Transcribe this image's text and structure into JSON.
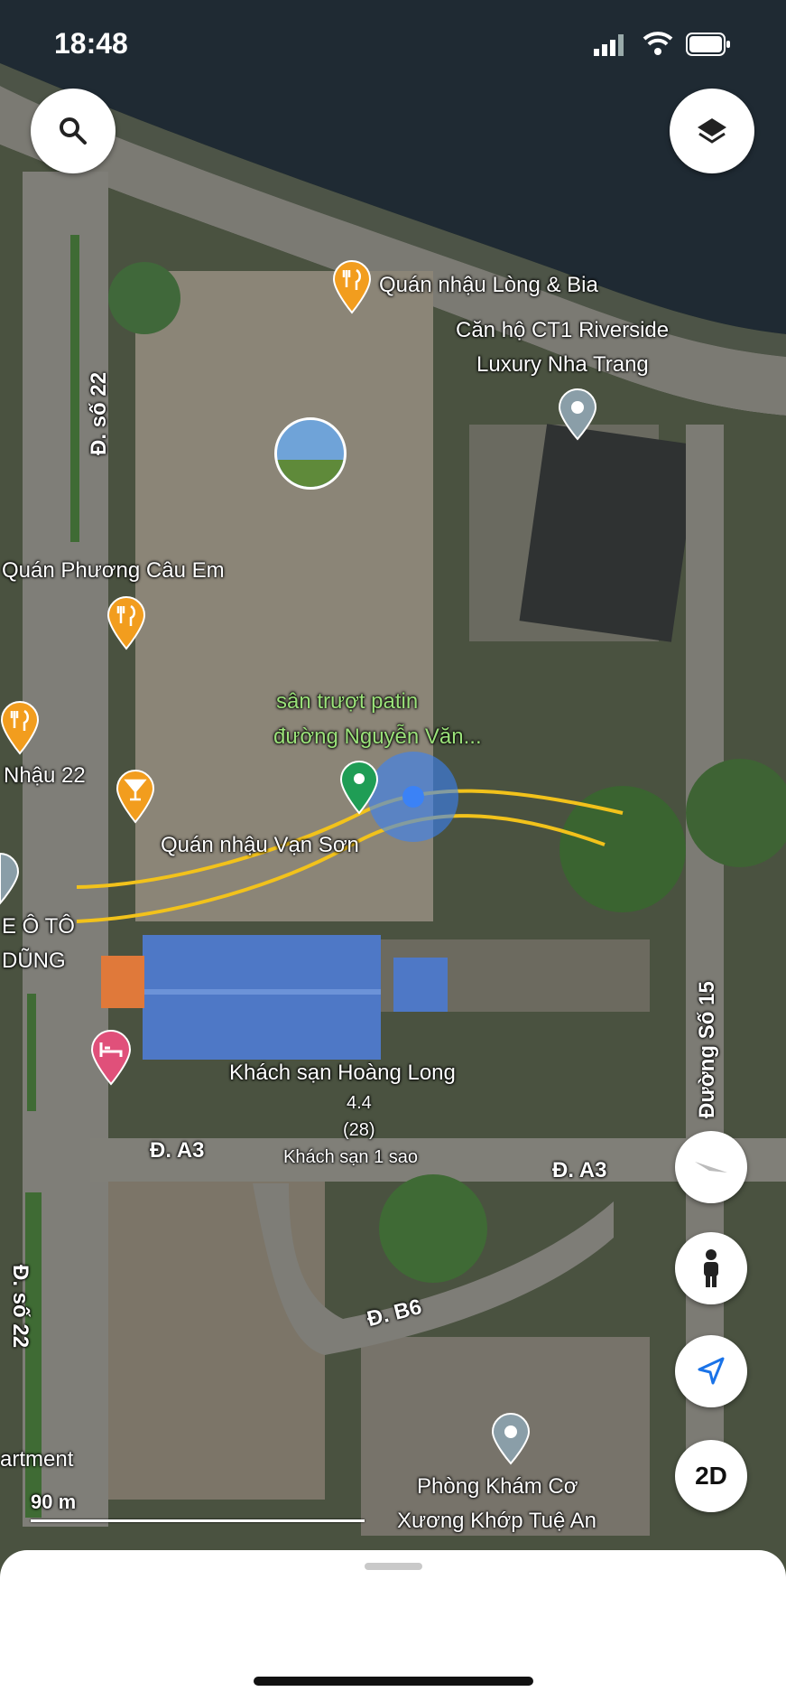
{
  "status_bar": {
    "time": "18:48"
  },
  "labels": {
    "quan_nhau_long_bia": "Quán nhậu Lòng & Bia",
    "ct1_line1": "Căn hộ CT1 Riverside",
    "ct1_line2": "Luxury Nha Trang",
    "quan_phuong_cau_em": "Quán Phương Câu Em",
    "patin_line1": "sân trượt patin",
    "patin_line2": "đường Nguyễn Văn...",
    "nhau_22": "Nhậu 22",
    "quan_nhau_van_son": "Quán nhậu Vạn Sơn",
    "oto_line1": "E Ô TÔ",
    "oto_line2": "DŨNG",
    "hotel_name": "Khách sạn Hoàng Long",
    "hotel_rating": "4.4",
    "hotel_reviews": "(28)",
    "hotel_class": "Khách sạn 1 sao",
    "road_a3_left": "Đ. A3",
    "road_a3_right": "Đ. A3",
    "road_b6": "Đ. B6",
    "road_so22_top": "Đ. số 22",
    "road_so22_bottom": "Đ. số 22",
    "road_so15": "Đường Số 15",
    "apartment": "artment",
    "clinic_line1": "Phòng Khám Cơ",
    "clinic_line2": "Xương Khớp Tuệ An"
  },
  "scale_bar": "90 m",
  "controls": {
    "search_icon": "search-icon",
    "layers_icon": "layers-icon",
    "compass_icon": "compass-icon",
    "pegman_icon": "pegman-icon",
    "location_icon": "my-location-icon",
    "view_mode": "2D"
  },
  "colors": {
    "food_pin": "#f29d1e",
    "place_pin": "#8a9ea8",
    "selected_pin": "#1f9d55",
    "hotel_pin": "#e0507a",
    "route": "#f2c21b"
  }
}
